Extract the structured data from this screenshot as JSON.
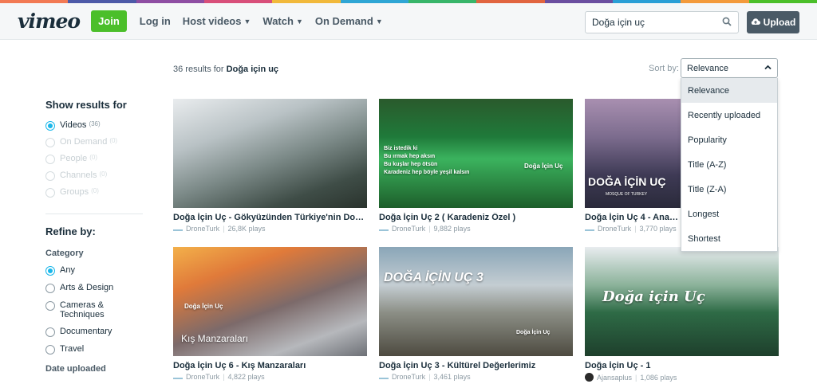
{
  "colors": {
    "accent": "#1ab7ea",
    "join": "#4bbf2a",
    "stripe": [
      "#f27a54",
      "#4d5aa8",
      "#8e4ea3",
      "#d84f7a",
      "#f1b93b",
      "#2fa6d5",
      "#38b56a",
      "#e16540",
      "#6b4fa0",
      "#2a9fd6",
      "#f39a3b",
      "#4bbf2a"
    ]
  },
  "header": {
    "logo": "vimeo",
    "join_label": "Join",
    "nav": [
      {
        "label": "Log in",
        "chevron": false
      },
      {
        "label": "Host videos",
        "chevron": true
      },
      {
        "label": "Watch",
        "chevron": true
      },
      {
        "label": "On Demand",
        "chevron": true
      }
    ],
    "search_value": "Doğa için uç",
    "search_icon": "search-icon",
    "upload_label": "Upload",
    "upload_icon": "cloud-upload-icon"
  },
  "results": {
    "count_prefix": "36 results for",
    "query": "Doğa için uç"
  },
  "sort": {
    "label": "Sort by:",
    "selected": "Relevance",
    "options": [
      "Relevance",
      "Recently uploaded",
      "Popularity",
      "Title (A-Z)",
      "Title (Z-A)",
      "Longest",
      "Shortest"
    ]
  },
  "sidebar": {
    "show_title": "Show results for",
    "show_options": [
      {
        "label": "Videos",
        "count": "(36)",
        "checked": true,
        "disabled": false
      },
      {
        "label": "On Demand",
        "count": "(0)",
        "checked": false,
        "disabled": true
      },
      {
        "label": "People",
        "count": "(0)",
        "checked": false,
        "disabled": true
      },
      {
        "label": "Channels",
        "count": "(0)",
        "checked": false,
        "disabled": true
      },
      {
        "label": "Groups",
        "count": "(0)",
        "checked": false,
        "disabled": true
      }
    ],
    "refine_title": "Refine by:",
    "category_title": "Category",
    "categories": [
      {
        "label": "Any",
        "checked": true
      },
      {
        "label": "Arts & Design",
        "checked": false
      },
      {
        "label": "Cameras & Techniques",
        "checked": false
      },
      {
        "label": "Documentary",
        "checked": false
      },
      {
        "label": "Travel",
        "checked": false
      }
    ],
    "date_title": "Date uploaded"
  },
  "videos": [
    {
      "title": "Doğa İçin Uç - Gökyüzünden Türkiye'nin Doğ...",
      "channel": "DroneTurk",
      "plays": "26,8K plays",
      "overlay": "",
      "overlay2": ""
    },
    {
      "title": "Doğa İçin Uç 2 ( Karadeniz Özel )",
      "channel": "DroneTurk",
      "plays": "9,882 plays",
      "overlay": "Biz istedik ki\nBu ırmak hep aksın\nBu kuşlar hep ötsün\nKaradeniz hep böyle yeşil kalsın",
      "overlay2": "Doğa İçin Uç"
    },
    {
      "title": "Doğa İçin Uç 4 - Anadolu",
      "channel": "DroneTurk",
      "plays": "3,770 plays",
      "overlay": "DOĞA İÇİN UÇ",
      "overlay2": "MOSQUE OF TURKEY"
    },
    {
      "title": "Doğa İçin Uç 6 - Kış Manzaraları",
      "channel": "DroneTurk",
      "plays": "4,822 plays",
      "overlay": "Kış Manzaraları",
      "overlay2": "Doğa İçin Uç"
    },
    {
      "title": "Doğa İçin Uç 3 - Kültürel Değerlerimiz",
      "channel": "DroneTurk",
      "plays": "3,461 plays",
      "overlay": "DOĞA İÇİN UÇ 3",
      "overlay2": "Doğa İçin Uç"
    },
    {
      "title": "Doğa İçin Uç - 1",
      "channel": "Ajansaplus",
      "plays": "1,086 plays",
      "overlay": "Doğa için Uç",
      "overlay2": ""
    }
  ]
}
